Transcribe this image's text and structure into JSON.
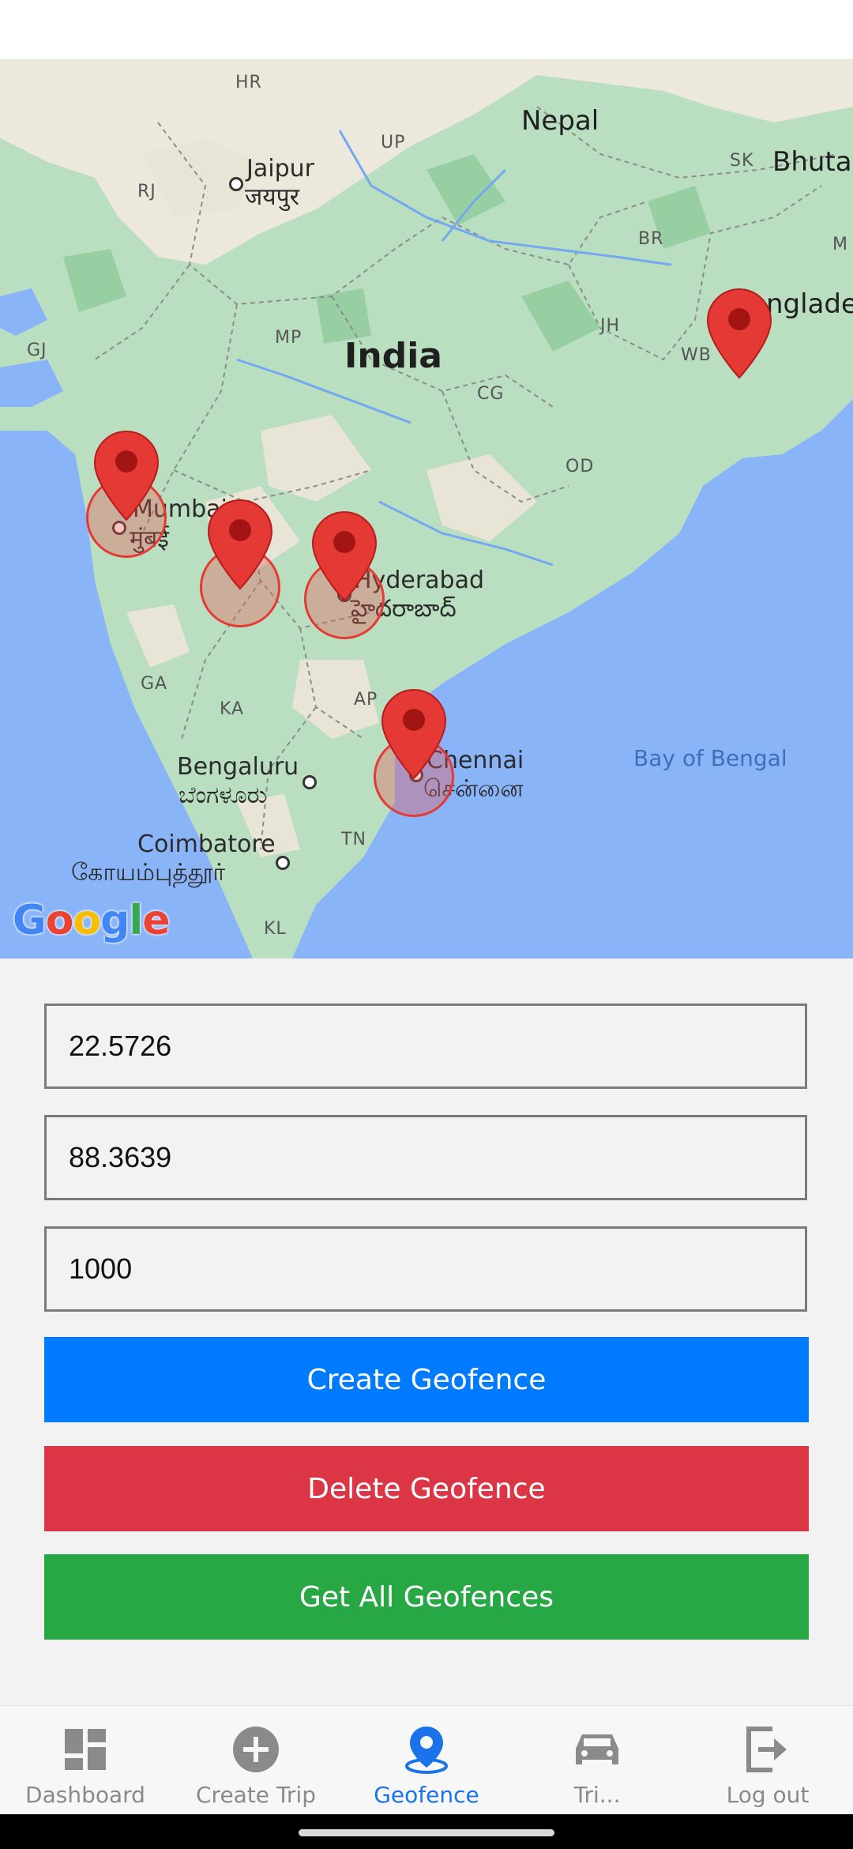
{
  "colors": {
    "create_button": "#007bff",
    "delete_button": "#dc3545",
    "get_all_button": "#28a745",
    "nav_active": "#1a73e8",
    "nav_inactive": "#8a8a8a",
    "marker": "#e53935"
  },
  "map": {
    "countries": {
      "india": "India",
      "nepal": "Nepal",
      "bhutan": "Bhuta",
      "bangladesh": "nglade"
    },
    "states": {
      "hr": "HR",
      "up": "UP",
      "rj": "RJ",
      "br": "BR",
      "sk": "SK",
      "m": "M",
      "jh": "JH",
      "gj": "GJ",
      "mp": "MP",
      "wb": "WB",
      "cg": "CG",
      "od": "OD",
      "ga": "GA",
      "ka": "KA",
      "ap": "AP",
      "tn": "TN",
      "kl": "KL"
    },
    "cities": {
      "jaipur": "Jaipur",
      "jaipur_local": "जयपुर",
      "mumbai": "Mumbai",
      "mumbai_local": "मुंबई",
      "hyderabad": "Hyderabad",
      "hyderabad_local": "హైదరాబాద్",
      "chennai": "Chennai",
      "chennai_local": "சென்னை",
      "bengaluru": "Bengaluru",
      "bengaluru_local": "ಬೆಂಗಳೂರು",
      "coimbatore": "Coimbatore",
      "coimbatore_local": "கோயம்புத்தூர்"
    },
    "water": {
      "bay": "Bay of Bengal"
    },
    "google_logo": [
      "G",
      "o",
      "o",
      "g",
      "l",
      "e"
    ]
  },
  "form": {
    "latitude": "22.5726",
    "longitude": "88.3639",
    "radius": "1000",
    "create_label": "Create Geofence",
    "delete_label": "Delete Geofence",
    "get_all_label": "Get All Geofences"
  },
  "nav": {
    "dashboard": "Dashboard",
    "create_trip": "Create Trip",
    "geofence": "Geofence",
    "trips": "Tri...",
    "logout": "Log out",
    "icons": [
      "dashboard-icon",
      "add-circle-icon",
      "location-pin-icon",
      "car-icon",
      "logout-icon"
    ]
  }
}
